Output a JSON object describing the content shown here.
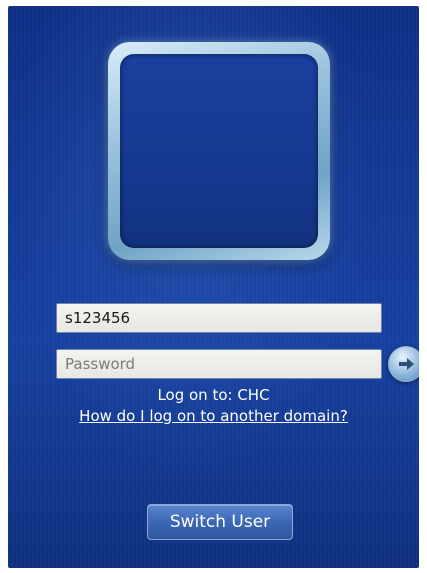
{
  "login": {
    "username_value": "s123456",
    "password_placeholder": "Password",
    "logon_to_text": "Log on to: CHC",
    "other_domain_link": "How do I log on to another domain?",
    "switch_user_label": "Switch User"
  },
  "icons": {
    "submit": "arrow-right-icon",
    "avatar": "user-picture-frame"
  },
  "colors": {
    "background": "#143a98",
    "text": "#ffffff",
    "field_background": "#eeeeea"
  }
}
